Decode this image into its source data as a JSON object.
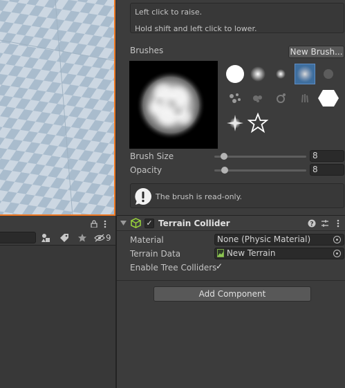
{
  "inspector": {
    "help_line1": "Left click to raise.",
    "help_line2": "Hold shift and left click to lower.",
    "brushes_label": "Brushes",
    "new_brush_label": "New Brush...",
    "brush_size_label": "Brush Size",
    "brush_size_value": "8",
    "brush_size_fraction": 0.07,
    "opacity_label": "Opacity",
    "opacity_value": "8",
    "opacity_fraction": 0.08,
    "readonly_text": "The brush is read-only.",
    "component": {
      "title": "Terrain Collider",
      "enabled": true,
      "material_label": "Material",
      "material_value": "None (Physic Material)",
      "terrain_data_label": "Terrain Data",
      "terrain_data_value": "New Terrain",
      "tree_colliders_label": "Enable Tree Colliders",
      "tree_colliders_enabled": true
    },
    "add_component_label": "Add Component"
  },
  "hierarchy": {
    "hidden_count": "9"
  },
  "colors": {
    "scene_border": "#f07820",
    "selected_brush": "#3e6e9e",
    "panel_bg": "#3c3c3c"
  }
}
